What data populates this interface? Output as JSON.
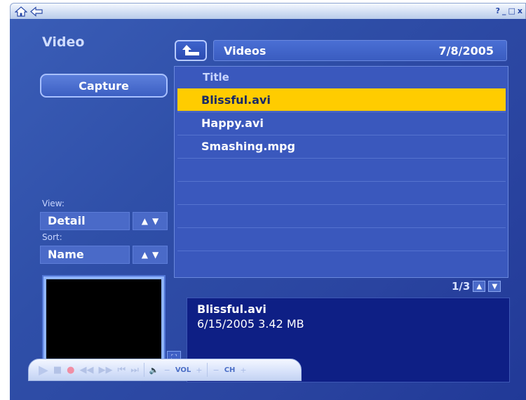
{
  "window": {
    "home_icon": "home-icon",
    "back_icon": "back-arrow-icon",
    "controls": [
      "?",
      "_",
      "□",
      "x"
    ]
  },
  "sidebar": {
    "title": "Video",
    "capture_label": "Capture",
    "view_label": "View:",
    "view_value": "Detail",
    "sort_label": "Sort:",
    "sort_value": "Name",
    "arrow_up": "▲",
    "arrow_down": "▼"
  },
  "header": {
    "folder": "Videos",
    "date": "7/8/2005"
  },
  "list": {
    "column_title": "Title",
    "items": [
      {
        "name": "Blissful.avi",
        "selected": true
      },
      {
        "name": "Happy.avi",
        "selected": false
      },
      {
        "name": "Smashing.mpg",
        "selected": false
      }
    ],
    "page": "1/3"
  },
  "details": {
    "name": "Blissful.avi",
    "meta": "6/15/2005  3.42 MB"
  },
  "transport": {
    "vol_label": "VOL",
    "ch_label": "CH",
    "minus": "−",
    "plus": "+"
  },
  "colors": {
    "background": "#2f4fa8",
    "selection": "#ffcc00",
    "details_panel": "#0e1f85"
  }
}
